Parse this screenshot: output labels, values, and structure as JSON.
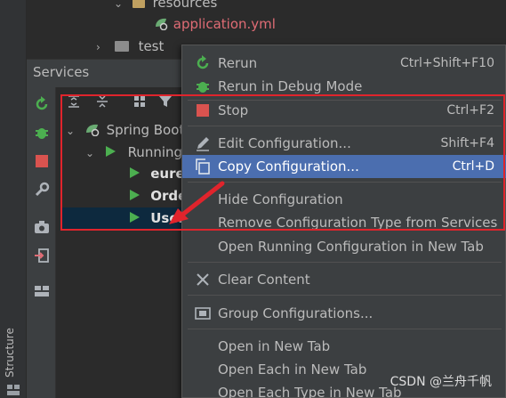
{
  "project_tree": {
    "resources_label": "resources",
    "application_file": "application.yml",
    "test_label": "test"
  },
  "services": {
    "title": "Services",
    "tree": {
      "spring_boot": "Spring Boot",
      "running": "Running",
      "items": [
        "eurel",
        "Orde",
        "User"
      ]
    }
  },
  "context_menu": {
    "items": [
      {
        "label": "Rerun",
        "shortcut": "Ctrl+Shift+F10",
        "icon": "rerun-icon"
      },
      {
        "label": "Rerun in Debug Mode",
        "shortcut": "",
        "icon": "debug-icon"
      },
      {
        "label": "Stop",
        "shortcut": "Ctrl+F2",
        "icon": "stop-icon"
      },
      {
        "label": "Edit Configuration...",
        "shortcut": "Shift+F4",
        "icon": "edit-icon"
      },
      {
        "label": "Copy Configuration...",
        "shortcut": "Ctrl+D",
        "icon": "copy-icon"
      },
      {
        "label": "Hide Configuration",
        "shortcut": "",
        "icon": ""
      },
      {
        "label": "Remove Configuration Type from Services",
        "shortcut": "",
        "icon": ""
      },
      {
        "label": "Open Running Configuration in New Tab",
        "shortcut": "",
        "icon": ""
      },
      {
        "label": "Clear Content",
        "shortcut": "",
        "icon": "clear-icon"
      },
      {
        "label": "Group Configurations...",
        "shortcut": "",
        "icon": "group-icon"
      },
      {
        "label": "Open in New Tab",
        "shortcut": "",
        "icon": ""
      },
      {
        "label": "Open Each in New Tab",
        "shortcut": "",
        "icon": ""
      },
      {
        "label": "Open Each Type in New Tab",
        "shortcut": "",
        "icon": ""
      }
    ],
    "highlighted": "Copy Configuration..."
  },
  "side_panel": {
    "structure_label": "Structure"
  },
  "watermark": "CSDN @兰舟千帆",
  "colors": {
    "annotation": "#e0242c",
    "highlight": "#4b6eaf",
    "run_green": "#4caf50",
    "stop_red": "#d9534f",
    "file_red": "#e06c75"
  }
}
